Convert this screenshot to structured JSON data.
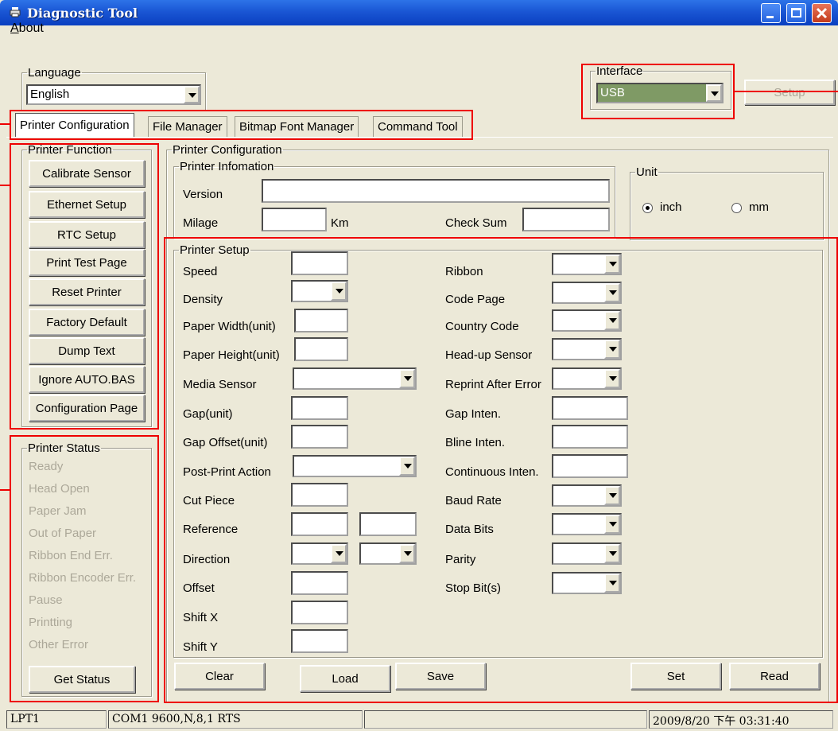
{
  "window": {
    "title": "Diagnostic Tool"
  },
  "menu": {
    "about_label": "About",
    "about_first": "A",
    "about_rest": "bout"
  },
  "language": {
    "legend": "Language",
    "selected": "English"
  },
  "interface": {
    "legend": "Interface",
    "selected": "USB",
    "setup_label": "Setup"
  },
  "tabs": [
    {
      "label": "Printer Configuration",
      "active": true
    },
    {
      "label": "File Manager",
      "active": false
    },
    {
      "label": "Bitmap Font Manager",
      "active": false
    },
    {
      "label": "Command Tool",
      "active": false
    }
  ],
  "printer_function": {
    "legend": "Printer Function",
    "buttons": [
      "Calibrate Sensor",
      "Ethernet Setup",
      "RTC Setup",
      "Print Test Page",
      "Reset Printer",
      "Factory Default",
      "Dump Text",
      "Ignore AUTO.BAS",
      "Configuration Page"
    ]
  },
  "printer_status": {
    "legend": "Printer Status",
    "items": [
      "Ready",
      "Head Open",
      "Paper Jam",
      "Out of Paper",
      "Ribbon End Err.",
      "Ribbon Encoder Err.",
      "Pause",
      "Printting",
      "Other Error"
    ],
    "get_status_label": "Get Status"
  },
  "config": {
    "legend": "Printer Configuration",
    "info": {
      "legend": "Printer Infomation",
      "version_label": "Version",
      "milage_label": "Milage",
      "km_label": "Km",
      "checksum_label": "Check Sum"
    },
    "unit": {
      "legend": "Unit",
      "inch_label": "inch",
      "mm_label": "mm",
      "selected": "inch"
    },
    "setup": {
      "legend": "Printer Setup",
      "left": {
        "speed": "Speed",
        "density": "Density",
        "paper_width": "Paper Width(unit)",
        "paper_height": "Paper Height(unit)",
        "media_sensor": "Media Sensor",
        "gap": "Gap(unit)",
        "gap_offset": "Gap Offset(unit)",
        "post_print": "Post-Print Action",
        "cut_piece": "Cut Piece",
        "reference": "Reference",
        "direction": "Direction",
        "offset": "Offset",
        "shift_x": "Shift X",
        "shift_y": "Shift Y"
      },
      "right": {
        "ribbon": "Ribbon",
        "code_page": "Code Page",
        "country_code": "Country Code",
        "headup_sensor": "Head-up Sensor",
        "reprint": "Reprint After Error",
        "gap_inten": "Gap Inten.",
        "bline_inten": "Bline Inten.",
        "continuous_inten": "Continuous Inten.",
        "baud_rate": "Baud Rate",
        "data_bits": "Data Bits",
        "parity": "Parity",
        "stop_bits": "Stop Bit(s)"
      }
    },
    "buttons": {
      "clear": "Clear",
      "load": "Load",
      "save": "Save",
      "set": "Set",
      "read": "Read"
    }
  },
  "statusbar": {
    "port": "LPT1",
    "com": "COM1 9600,N,8,1 RTS",
    "datetime": "2009/8/20 下午 03:31:40"
  },
  "colors": {
    "title_bar": "#1a56d4",
    "window_bg": "#ece9d8",
    "highlight": "#e00000",
    "disabled_text": "#aca899"
  }
}
